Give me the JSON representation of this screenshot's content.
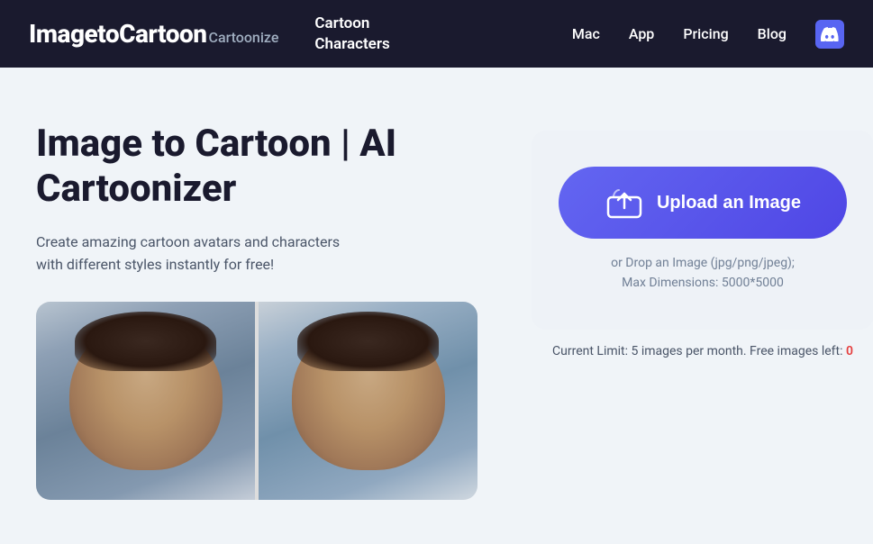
{
  "header": {
    "logo_main": "ImagetoCartoon",
    "logo_sub": "Cartoonize",
    "cartoon_nav_line1": "Cartoon",
    "cartoon_nav_line2": "Characters",
    "nav_items": [
      "Mac",
      "App",
      "Pricing",
      "Blog"
    ],
    "discord_label": "Discord"
  },
  "main": {
    "page_title": "Image to Cartoon | AI Cartoonizer",
    "page_description": "Create amazing cartoon avatars and characters\nwith different styles instantly for free!",
    "upload_button_label": "Upload an Image",
    "upload_hint_line1": "or Drop an Image (jpg/png/jpeg);",
    "upload_hint_line2": "Max Dimensions: 5000*5000",
    "limit_text_prefix": "Current Limit: 5 images per month. Free images left: ",
    "limit_count": "0"
  }
}
